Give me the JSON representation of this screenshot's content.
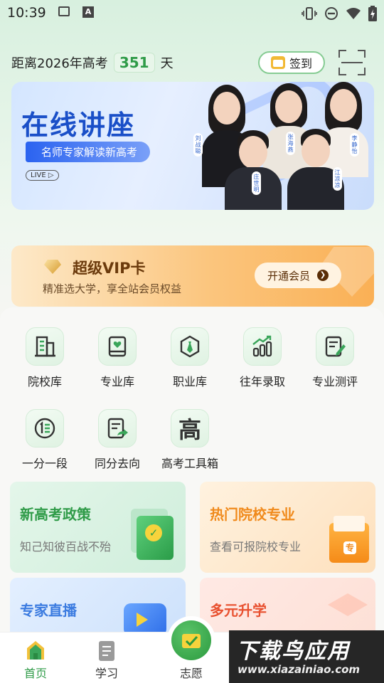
{
  "status_bar": {
    "time": "10:39",
    "icons_left": [
      "image-icon",
      "a-text-icon"
    ],
    "icons_right": [
      "vibrate-icon",
      "dnd-icon",
      "wifi-icon",
      "battery-icon"
    ]
  },
  "header": {
    "countdown_prefix": "距离2026年高考",
    "countdown_days": "351",
    "countdown_suffix": "天",
    "checkin_label": "签到",
    "scan_icon": "scan-icon"
  },
  "banner": {
    "title": "在线讲座",
    "subtitle": "名师专家解读新高考",
    "live_badge": "LIVE ▷",
    "lecturers": [
      "刘战聪",
      "张海燕",
      "李静怡",
      "庄世明",
      "江凉凉"
    ]
  },
  "vip": {
    "title": "超级VIP卡",
    "subtitle": "精准选大学，享全站会员权益",
    "button": "开通会员",
    "accent": "#fab055"
  },
  "grid": {
    "row1": [
      {
        "label": "院校库",
        "icon": "building-icon"
      },
      {
        "label": "专业库",
        "icon": "book-heart-icon"
      },
      {
        "label": "职业库",
        "icon": "tie-icon"
      },
      {
        "label": "往年录取",
        "icon": "bar-chart-icon"
      },
      {
        "label": "专业测评",
        "icon": "edit-note-icon"
      }
    ],
    "row2": [
      {
        "label": "一分一段",
        "icon": "ranking-icon"
      },
      {
        "label": "同分去向",
        "icon": "document-arrow-icon"
      },
      {
        "label": "高考工具箱",
        "icon": "toolbox-icon",
        "glyph": "高"
      }
    ]
  },
  "cards": [
    {
      "title": "新高考政策",
      "subtitle": "知己知彼百战不殆",
      "color": "#2f9b48"
    },
    {
      "title": "热门院校专业",
      "subtitle": "查看可报院校专业",
      "color": "#f08a1c"
    },
    {
      "title": "专家直播",
      "subtitle": "",
      "color": "#3b7be0"
    },
    {
      "title": "多元升学",
      "subtitle": "",
      "color": "#e8502f"
    }
  ],
  "bottom_nav": {
    "home": "首页",
    "study": "学习",
    "volunteer": "志愿"
  },
  "watermark": {
    "title": "下载鸟应用",
    "url": "www.xiazainiao.com"
  },
  "colors": {
    "primary_green": "#2f9b48",
    "orange": "#f08a1c"
  }
}
